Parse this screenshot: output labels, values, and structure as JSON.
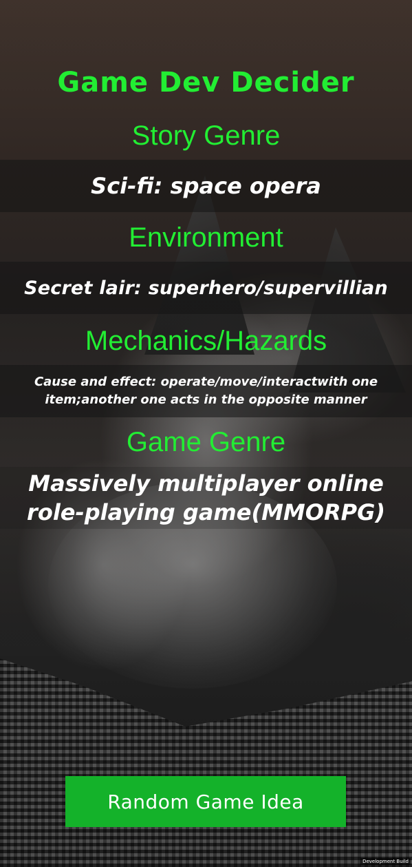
{
  "app": {
    "title": "Game Dev Decider"
  },
  "sections": [
    {
      "heading": "Story Genre",
      "value": "Sci-fi: space opera"
    },
    {
      "heading": "Environment",
      "value": "Secret lair: superhero/supervillian"
    },
    {
      "heading": "Mechanics/Hazards",
      "value": "Cause and effect: operate/move/interactwith one item;another one acts in the opposite manner"
    },
    {
      "heading": "Game Genre",
      "value": "Massively multiplayer online role-playing game(MMORPG)"
    }
  ],
  "button": {
    "label": "Random Game Idea"
  },
  "footer": {
    "build_label": "Development Build"
  },
  "colors": {
    "accent_green": "#22ee33",
    "button_green": "#14b22a",
    "value_text": "#ffffff"
  },
  "background": {
    "image": "husky-dog-photo"
  }
}
